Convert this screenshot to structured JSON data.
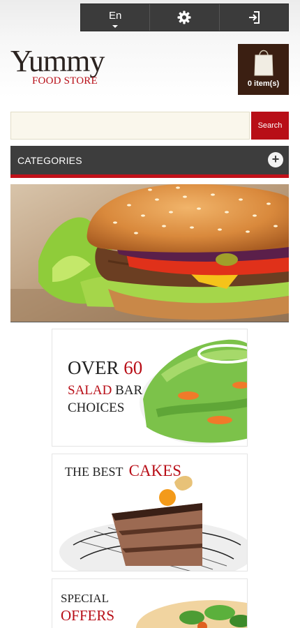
{
  "topbar": {
    "language": "En"
  },
  "logo": {
    "name": "Yummy",
    "tagline": "FOOD STORE"
  },
  "cart": {
    "label": "0 item(s)"
  },
  "search": {
    "button": "Search",
    "placeholder": ""
  },
  "categories": {
    "label": "CATEGORIES",
    "toggle": "+"
  },
  "banners": [
    {
      "line1a": "OVER",
      "line1b": "60",
      "line2a": "SALAD",
      "line2b": "BAR",
      "line3": "CHOICES"
    },
    {
      "line1a": "THE BEST",
      "line1b": "CAKES"
    },
    {
      "line1": "SPECIAL",
      "line2": "OFFERS"
    }
  ],
  "colors": {
    "accent": "#b80e17",
    "dark_bar": "#3b3b3b",
    "cart_bg": "#3b1f12"
  }
}
